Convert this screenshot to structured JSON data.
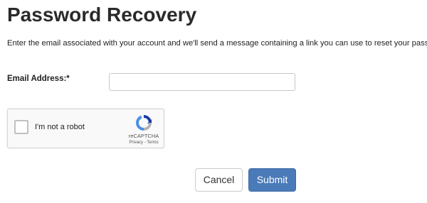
{
  "page": {
    "title": "Password Recovery",
    "instructions": "Enter the email associated with your account and we'll send a message containing a link you can use to reset your password."
  },
  "form": {
    "email_label": "Email Address:*",
    "email_value": "",
    "email_placeholder": ""
  },
  "recaptcha": {
    "checkbox_label": "I'm not a robot",
    "checked": false,
    "brand": "reCAPTCHA",
    "privacy_link": "Privacy",
    "separator": " - ",
    "terms_link": "Terms",
    "logo_icon": "recaptcha-logo-icon"
  },
  "actions": {
    "cancel_label": "Cancel",
    "submit_label": "Submit"
  },
  "colors": {
    "submit_bg": "#4a7ab8",
    "recaptcha_blue": "#1c3aa9",
    "recaptcha_lightblue": "#4a90e2",
    "recaptcha_grey": "#b3b3b3"
  }
}
